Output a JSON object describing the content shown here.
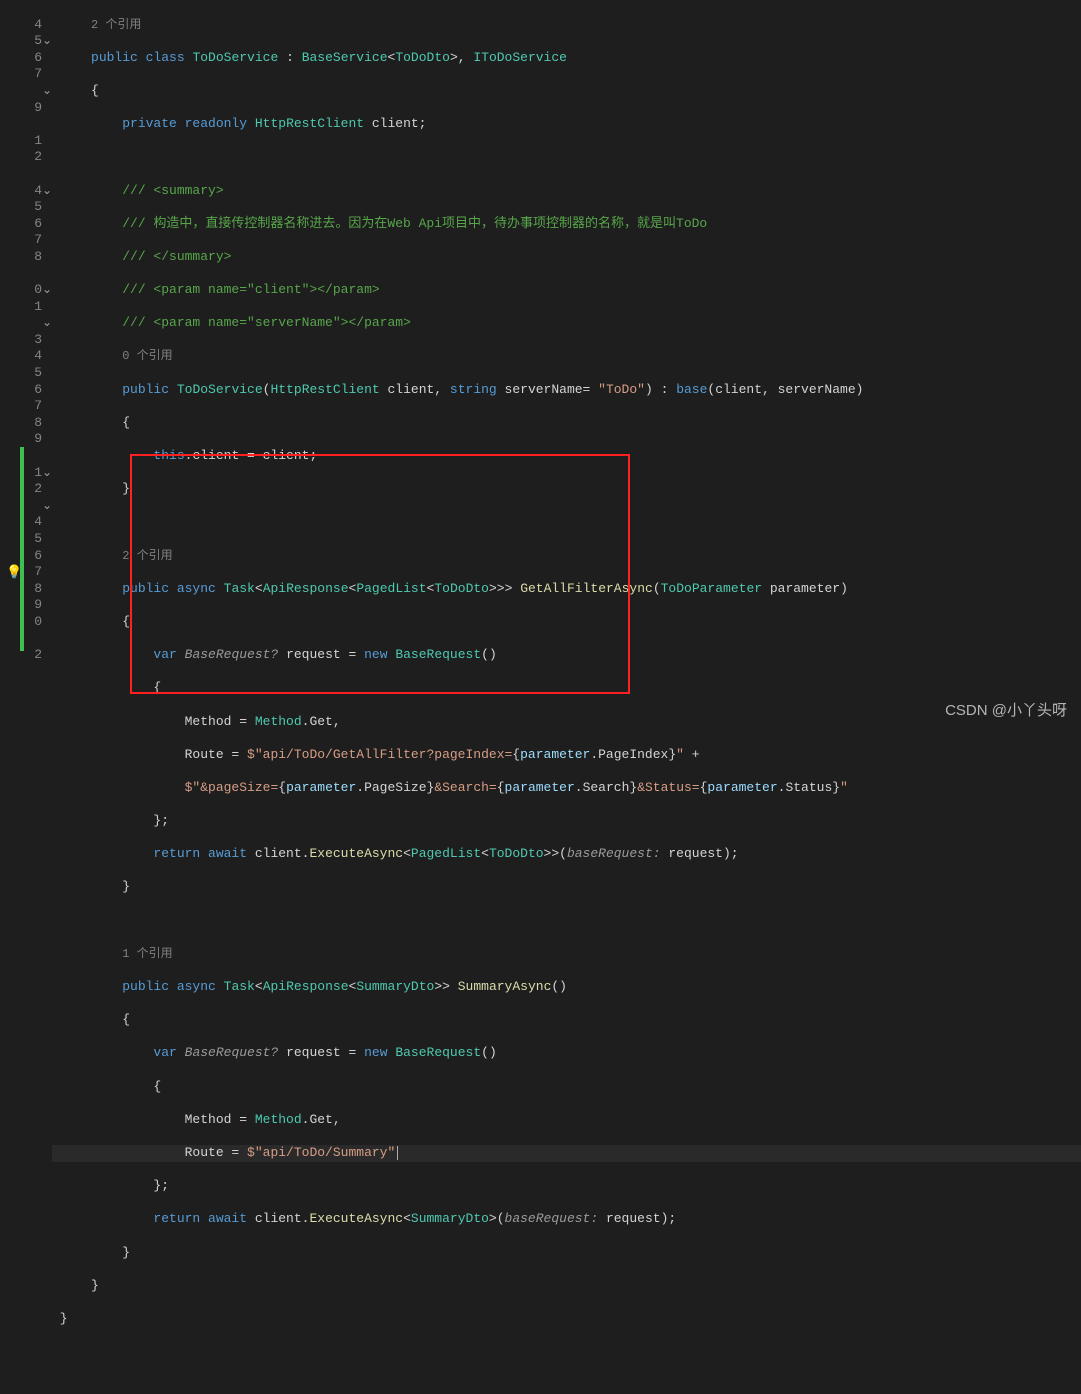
{
  "refs": {
    "r2a": "2 个引用",
    "r0": "0 个引用",
    "r2b": "2 个引用",
    "r1": "1 个引用"
  },
  "code": {
    "l_classDecl": {
      "kw1": "public class",
      "cls": "ToDoService",
      "colon": " : ",
      "base": "BaseService",
      "lt": "<",
      "dto": "ToDoDto",
      "gt": ">, ",
      "iface": "IToDoService"
    },
    "l_private": {
      "kw": "private readonly",
      "type": "HttpRestClient",
      "name": " client;"
    },
    "c1": "/// <summary>",
    "c2": "/// 构造中，直接传控制器名称进去。因为在Web Api项目中，待办事项控制器的名称，就是叫ToDo",
    "c3": "/// </summary>",
    "c4a": "/// <param name=\"",
    "c4b": "client",
    "c4c": "\"></param>",
    "c5a": "/// <param name=\"",
    "c5b": "serverName",
    "c5c": "\"></param>",
    "ctor": {
      "kw": "public",
      "name": "ToDoService",
      "paren": "(",
      "t1": "HttpRestClient",
      "p1": " client, ",
      "t2": "string",
      "p2": " serverName= ",
      "s": "\"ToDo\"",
      "paren2": ") : ",
      "base": "base",
      "args": "(client, serverName)"
    },
    "ctorBody": {
      "thiskw": "this",
      "rest": ".client = client;"
    },
    "m1": {
      "kw": "public async",
      "task": "Task",
      "ar": "ApiResponse",
      "pl": "PagedList",
      "dto": "ToDoDto",
      "name": "GetAllFilterAsync",
      "pType": "ToDoParameter",
      "pName": " parameter",
      "close": ")"
    },
    "m1_var": {
      "kw": "var",
      "hint": "BaseRequest?",
      "name": " request = ",
      "newkw": "new",
      "type": "BaseRequest",
      "paren": "()"
    },
    "m1_method": {
      "l": "Method = ",
      "t": "Method",
      "r": ".Get,"
    },
    "m1_route1": {
      "l": "Route = ",
      "d": "$\"api/ToDo/GetAllFilter?pageIndex=",
      "b1": "{",
      "p": "parameter",
      "f": ".PageIndex",
      "b2": "}",
      "q": "\"",
      "plus": " +"
    },
    "m1_route2": {
      "d": "$\"&pageSize=",
      "b1": "{",
      "p1": "parameter",
      "f1": ".PageSize",
      "b2": "}",
      "d2": "&Search=",
      "b3": "{",
      "p2": "parameter",
      "f2": ".Search",
      "b4": "}",
      "d3": "&Status=",
      "b5": "{",
      "p3": "parameter",
      "f3": ".Status",
      "b6": "}",
      "q": "\""
    },
    "m1_ret": {
      "kw": "return await",
      "obj": " client.",
      "meth": "ExecuteAsync",
      "lt": "<",
      "pl": "PagedList",
      "lt2": "<",
      "dto": "ToDoDto",
      "gt": ">>(",
      "hint": "baseRequest:",
      "arg": " request);"
    },
    "m2": {
      "kw": "public async",
      "task": "Task",
      "ar": "ApiResponse",
      "dto": "SummaryDto",
      "name": "SummaryAsync",
      "paren": "()"
    },
    "m2_var": {
      "kw": "var",
      "hint": "BaseRequest?",
      "name": " request = ",
      "newkw": "new",
      "type": "BaseRequest",
      "paren": "()"
    },
    "m2_method": {
      "l": "Method = ",
      "t": "Method",
      "r": ".Get,"
    },
    "m2_route": {
      "l": "Route = ",
      "d": "$\"api/ToDo/Summary\""
    },
    "m2_ret": {
      "kw": "return await",
      "obj": " client.",
      "meth": "ExecuteAsync",
      "lt": "<",
      "dto": "SummaryDto",
      "gt": ">(",
      "hint": "baseRequest:",
      "arg": " request);"
    }
  },
  "watermark": "CSDN @小丫头呀"
}
